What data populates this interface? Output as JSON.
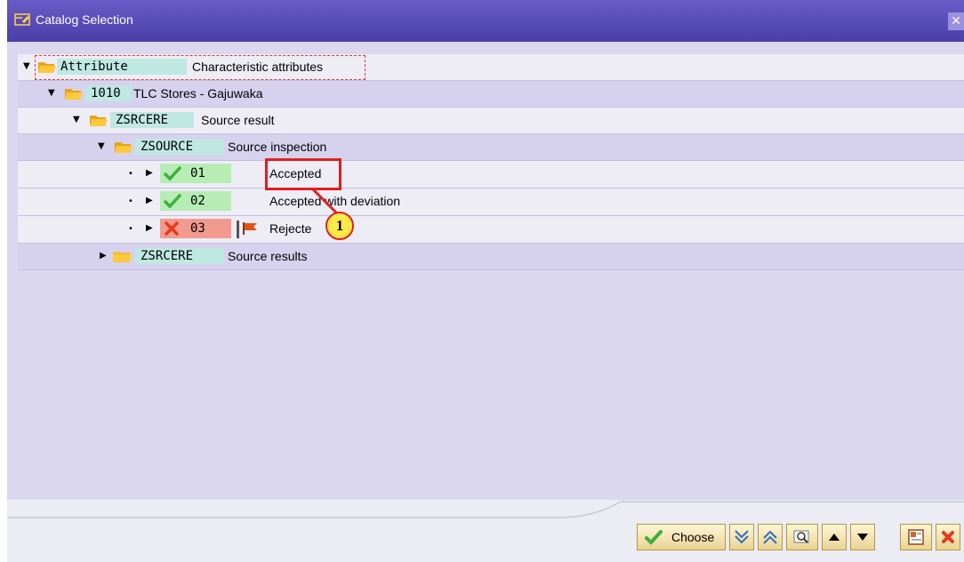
{
  "window": {
    "title": "Catalog Selection",
    "close_glyph": "✕"
  },
  "tree": {
    "root": {
      "code": "Attribute",
      "text": "Characteristic attributes"
    },
    "plant": {
      "code": "1010",
      "text": "TLC Stores - Gajuwaka"
    },
    "group1": {
      "code": "ZSRCERE",
      "text": "Source result"
    },
    "group2": {
      "code": "ZSOURCE",
      "text": "Source inspection"
    },
    "codes": [
      {
        "code": "01",
        "text": "Accepted",
        "status": "accepted",
        "status_icon": "green-check-icon"
      },
      {
        "code": "02",
        "text": "Accepted with deviation",
        "status": "accepted",
        "status_icon": "green-check-icon"
      },
      {
        "code": "03",
        "text": "Rejecte",
        "status": "rejected",
        "status_icon": "red-x-icon",
        "flag_icon": "red-flag-icon"
      }
    ],
    "group3": {
      "code": "ZSRCERE",
      "text": "Source results"
    }
  },
  "annotation": {
    "number": "1"
  },
  "toolbar": {
    "choose_label": "Choose",
    "buttons": [
      "choose-button",
      "expand-all-button",
      "collapse-all-button",
      "find-button",
      "previous-button",
      "next-button",
      "info-button",
      "cancel-button"
    ]
  },
  "colors": {
    "titlebar": "#5548b8",
    "accepted_bg": "#b7ecb5",
    "rejected_bg": "#f29a8f",
    "key_bg": "#bfe8e3",
    "highlight_box": "#e01f1f"
  }
}
